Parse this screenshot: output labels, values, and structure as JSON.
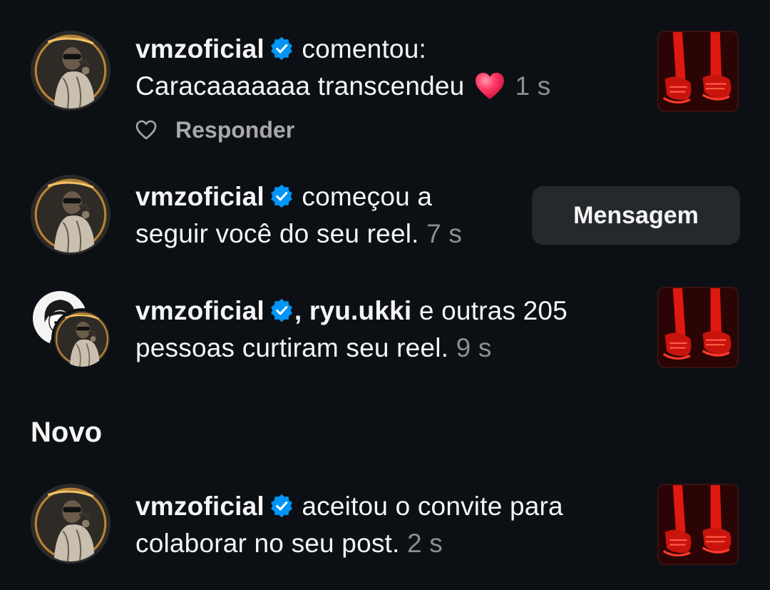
{
  "colors": {
    "background": "#0c1014",
    "verified_badge": "#0095f6",
    "secondary_text": "#8e8e8e",
    "button_bg": "#25292e",
    "thumbnail_red": "#e0190f"
  },
  "notifications": [
    {
      "username": "vmzoficial",
      "verified": true,
      "action": "comentou:",
      "comment": "Caracaaaaaaa transcendeu",
      "emoji": "red-heart",
      "time": "1 s",
      "reply_label": "Responder",
      "like_icon": "heart-outline-icon",
      "thumbnail": "red-sneakers-reel"
    },
    {
      "username": "vmzoficial",
      "verified": true,
      "line1": "começou a",
      "line2": "seguir você do seu reel.",
      "time": "7 s",
      "button_label": "Mensagem"
    },
    {
      "username": "vmzoficial",
      "verified": true,
      "separator": ",",
      "second_username": "ryu.ukki",
      "line1": "e outras 205",
      "line2": "pessoas curtiram seu reel.",
      "time": "9 s",
      "thumbnail": "red-sneakers-reel"
    }
  ],
  "new_section": {
    "title": "Novo",
    "items": [
      {
        "username": "vmzoficial",
        "verified": true,
        "line1": "aceitou o convite para",
        "line2": "colaborar no seu post.",
        "time": "2 s",
        "thumbnail": "red-sneakers-reel"
      }
    ]
  }
}
